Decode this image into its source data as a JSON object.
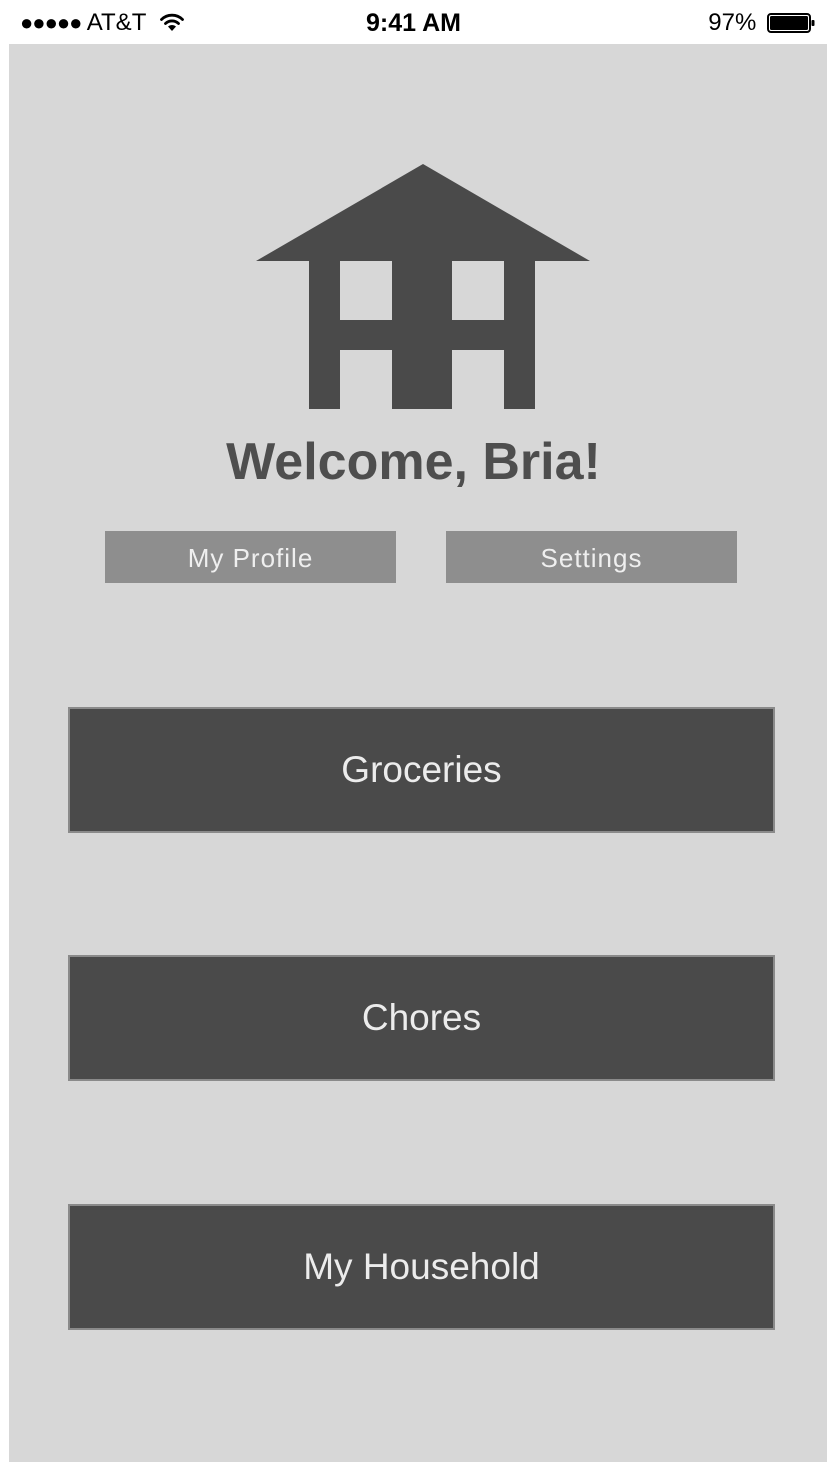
{
  "status_bar": {
    "signal": "●●●●●",
    "carrier": "AT&T",
    "time": "9:41 AM",
    "battery_percent": "97%",
    "battery_level": 0.97,
    "icons": [
      "wifi-icon",
      "battery-icon"
    ]
  },
  "logo": {
    "icon": "house-icon",
    "color": "#4a4a4a"
  },
  "welcome_text": "Welcome, Bria!",
  "top_buttons": {
    "profile_label": "My Profile",
    "settings_label": "Settings"
  },
  "menu": {
    "groceries_label": "Groceries",
    "chores_label": "Chores",
    "household_label": "My Household"
  },
  "colors": {
    "background": "#d7d7d7",
    "primary_button": "#4a4a4a",
    "secondary_button": "#8e8e8e",
    "heading_text": "#4e4e4e"
  }
}
